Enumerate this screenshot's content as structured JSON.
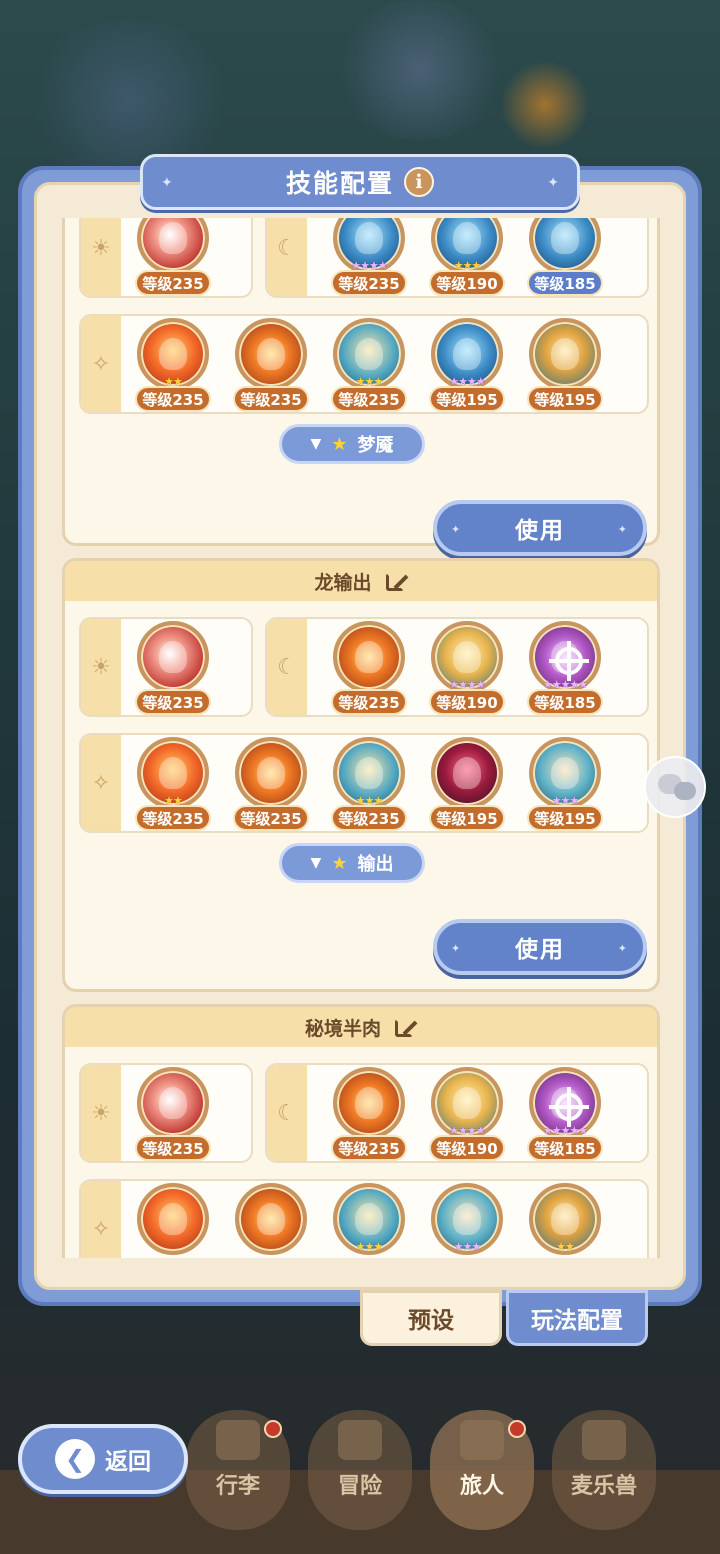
{
  "title": "技能配置",
  "info_icon": "i",
  "tabs": {
    "preset": "预设",
    "play_config": "玩法配置"
  },
  "back_label": "返回",
  "nav": [
    {
      "label": "行李"
    },
    {
      "label": "冒险"
    },
    {
      "label": "旅人"
    },
    {
      "label": "麦乐兽"
    }
  ],
  "use_label": "使用",
  "presets": [
    {
      "name": "",
      "chip": "梦魇",
      "row1_left": [
        {
          "icon": "fire-slash",
          "level": "等级235"
        }
      ],
      "row1_right": [
        {
          "icon": "blue-orb",
          "level": "等级235"
        },
        {
          "icon": "blue-orb",
          "level": "等级190"
        },
        {
          "icon": "blue-orb",
          "level": "等级185"
        }
      ],
      "row2": [
        {
          "icon": "fire-warrior",
          "level": "等级235"
        },
        {
          "icon": "flame-swirl",
          "level": "等级235"
        },
        {
          "icon": "wind-slash",
          "level": "等级235"
        },
        {
          "icon": "blue-beast",
          "level": "等级195"
        },
        {
          "icon": "gold-fist",
          "level": "等级195"
        }
      ]
    },
    {
      "name": "龙输出",
      "chip": "输出",
      "row1_left": [
        {
          "icon": "red-sword",
          "level": "等级235"
        }
      ],
      "row1_right": [
        {
          "icon": "flame-claw",
          "level": "等级235"
        },
        {
          "icon": "gold-burst",
          "level": "等级190"
        },
        {
          "icon": "purple-target",
          "level": "等级185"
        }
      ],
      "row2": [
        {
          "icon": "fire-warrior",
          "level": "等级235"
        },
        {
          "icon": "flame-swirl",
          "level": "等级235"
        },
        {
          "icon": "wind-slash",
          "level": "等级235"
        },
        {
          "icon": "shadow-demon",
          "level": "等级195"
        },
        {
          "icon": "claw-strike",
          "level": "等级195"
        }
      ]
    },
    {
      "name": "秘境半肉",
      "row1_left": [
        {
          "icon": "red-sword",
          "level": "等级235"
        }
      ],
      "row1_right": [
        {
          "icon": "flame-claw",
          "level": "等级235"
        },
        {
          "icon": "gold-burst",
          "level": "等级190"
        },
        {
          "icon": "purple-target",
          "level": "等级185"
        }
      ],
      "row2": [
        {
          "icon": "fire-warrior"
        },
        {
          "icon": "flame-swirl"
        },
        {
          "icon": "wind-slash"
        },
        {
          "icon": "claw-strike"
        },
        {
          "icon": "gold-fist"
        }
      ]
    }
  ],
  "colors": {
    "panel": "#7f9cd6",
    "level_badge": "#c46c2c",
    "level_badge_blue": "#5c7dcc",
    "cream": "#fdf7ea"
  }
}
